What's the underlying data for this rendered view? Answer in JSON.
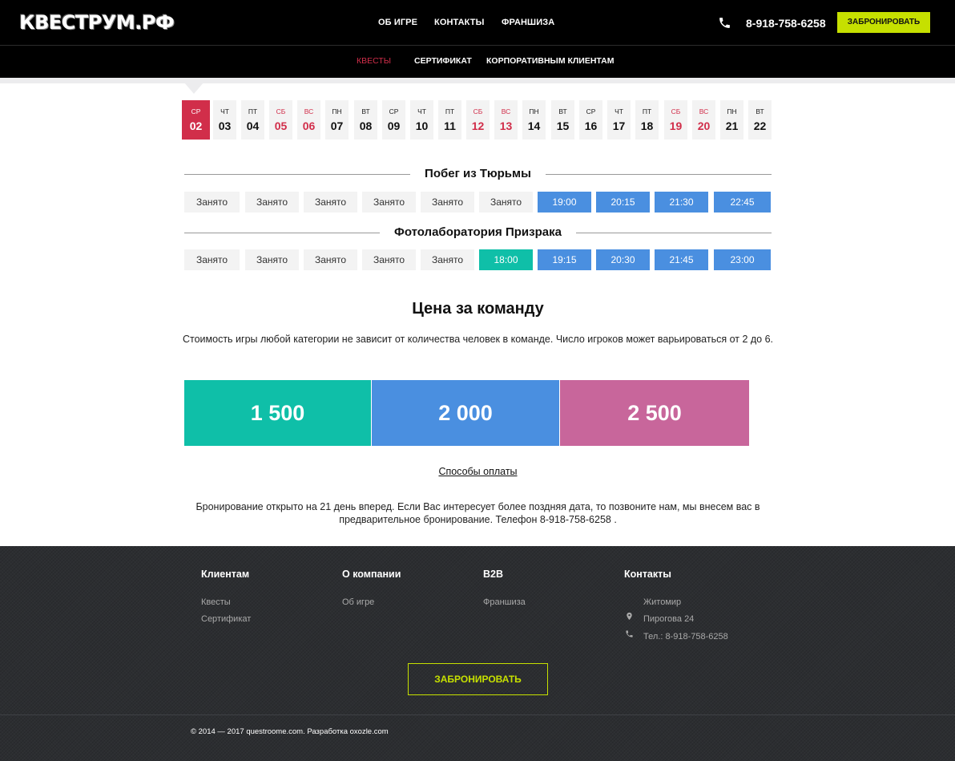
{
  "header": {
    "logo": "КВЕСТРУМ.РФ",
    "nav": [
      "Об игре",
      "Контакты",
      "Франшиза"
    ],
    "phone": "8-918-758-6258",
    "book_label": "Забронировать"
  },
  "subnav": {
    "items": [
      "Квесты",
      "Сертификат",
      "Корпоративным клиентам"
    ],
    "active": "Квесты"
  },
  "calendar": [
    {
      "dow": "ср",
      "num": "02",
      "weekend": false,
      "active": true
    },
    {
      "dow": "чт",
      "num": "03",
      "weekend": false
    },
    {
      "dow": "пт",
      "num": "04",
      "weekend": false
    },
    {
      "dow": "сб",
      "num": "05",
      "weekend": true
    },
    {
      "dow": "вс",
      "num": "06",
      "weekend": true
    },
    {
      "dow": "пн",
      "num": "07",
      "weekend": false
    },
    {
      "dow": "вт",
      "num": "08",
      "weekend": false
    },
    {
      "dow": "ср",
      "num": "09",
      "weekend": false
    },
    {
      "dow": "чт",
      "num": "10",
      "weekend": false
    },
    {
      "dow": "пт",
      "num": "11",
      "weekend": false
    },
    {
      "dow": "сб",
      "num": "12",
      "weekend": true
    },
    {
      "dow": "вс",
      "num": "13",
      "weekend": true
    },
    {
      "dow": "пн",
      "num": "14",
      "weekend": false
    },
    {
      "dow": "вт",
      "num": "15",
      "weekend": false
    },
    {
      "dow": "ср",
      "num": "16",
      "weekend": false
    },
    {
      "dow": "чт",
      "num": "17",
      "weekend": false
    },
    {
      "dow": "пт",
      "num": "18",
      "weekend": false
    },
    {
      "dow": "сб",
      "num": "19",
      "weekend": true
    },
    {
      "dow": "вс",
      "num": "20",
      "weekend": true
    },
    {
      "dow": "пн",
      "num": "21",
      "weekend": false
    },
    {
      "dow": "вт",
      "num": "22",
      "weekend": false
    }
  ],
  "quests": [
    {
      "title": "Побег из Тюрьмы",
      "slots": [
        {
          "label": "Занято",
          "state": "busy"
        },
        {
          "label": "Занято",
          "state": "busy"
        },
        {
          "label": "Занято",
          "state": "busy"
        },
        {
          "label": "Занято",
          "state": "busy"
        },
        {
          "label": "Занято",
          "state": "busy"
        },
        {
          "label": "Занято",
          "state": "busy"
        },
        {
          "label": "19:00",
          "state": "free"
        },
        {
          "label": "20:15",
          "state": "free"
        },
        {
          "label": "21:30",
          "state": "free"
        },
        {
          "label": "22:45",
          "state": "free"
        }
      ]
    },
    {
      "title": "Фотолаборатория Призрака",
      "slots": [
        {
          "label": "Занято",
          "state": "busy"
        },
        {
          "label": "Занято",
          "state": "busy"
        },
        {
          "label": "Занято",
          "state": "busy"
        },
        {
          "label": "Занято",
          "state": "busy"
        },
        {
          "label": "Занято",
          "state": "busy"
        },
        {
          "label": "18:00",
          "state": "special"
        },
        {
          "label": "19:15",
          "state": "free"
        },
        {
          "label": "20:30",
          "state": "free"
        },
        {
          "label": "21:45",
          "state": "free"
        },
        {
          "label": "23:00",
          "state": "free"
        }
      ]
    }
  ],
  "pricing": {
    "title": "Цена за команду",
    "description": "Стоимость игры любой категории не зависит от количества человек в команде. Число игроков может варьироваться от 2 до 6.",
    "prices": [
      {
        "value": "1 500",
        "color": "#0fbfa8"
      },
      {
        "value": "2 000",
        "color": "#4a8fe0"
      },
      {
        "value": "2 500",
        "color": "#c8669b"
      }
    ],
    "payment_link": "Способы оплаты",
    "booking_note": "Бронирование открыто на 21 день вперед. Если Вас интересует более поздняя дата, то позвоните нам, мы внесем вас в предварительное бронирование. Телефон 8-918-758-6258 ."
  },
  "footer": {
    "columns": [
      {
        "title": "Клиентам",
        "links": [
          "Квесты",
          "Сертификат"
        ]
      },
      {
        "title": "О компании",
        "links": [
          "Об игре"
        ]
      },
      {
        "title": "B2B",
        "links": [
          "Франшиза"
        ]
      }
    ],
    "contacts": {
      "title": "Контакты",
      "city": "Житомир",
      "address": "Пирогова 24",
      "phone": "Тел.: 8-918-758-6258"
    },
    "book_label": "Забронировать",
    "copyright": "© 2014 — 2017 questroome.com. Разработка oxozle.com"
  },
  "colors": {
    "accent_red": "#d12e4a",
    "lime": "#c6e000",
    "slot_blue": "#4a8fe0",
    "teal": "#0fbfa8",
    "pink": "#c8669b"
  }
}
